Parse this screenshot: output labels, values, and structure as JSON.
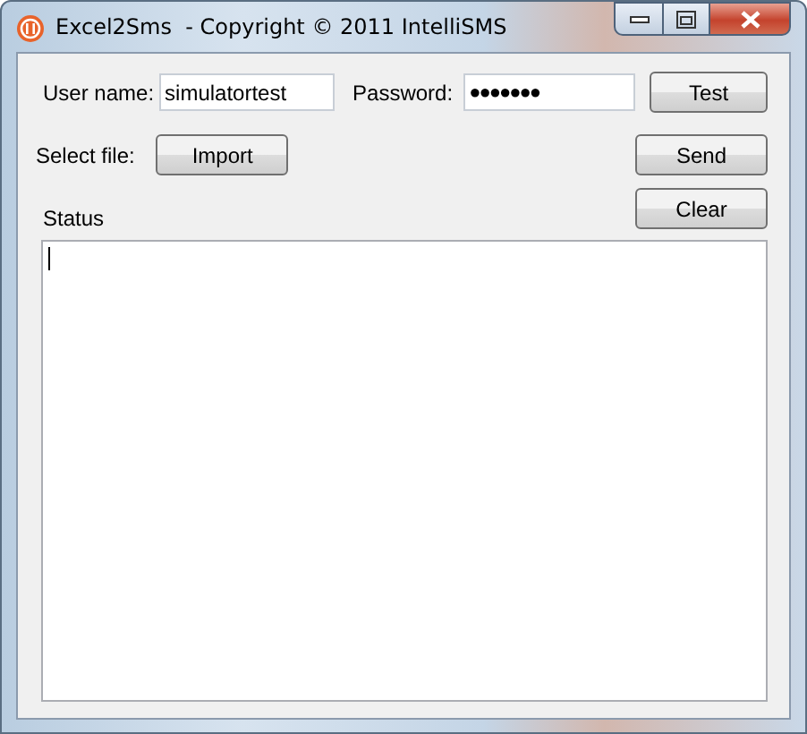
{
  "window": {
    "title": "Excel2Sms  - Copyright © 2011 IntelliSMS"
  },
  "login": {
    "user_label": "User name:",
    "user_value": "simulatortest",
    "password_label": "Password:",
    "password_value": "●●●●●●●",
    "test_button": "Test"
  },
  "file": {
    "label": "Select file:",
    "import_button": "Import",
    "send_button": "Send"
  },
  "status": {
    "label": "Status",
    "clear_button": "Clear"
  }
}
